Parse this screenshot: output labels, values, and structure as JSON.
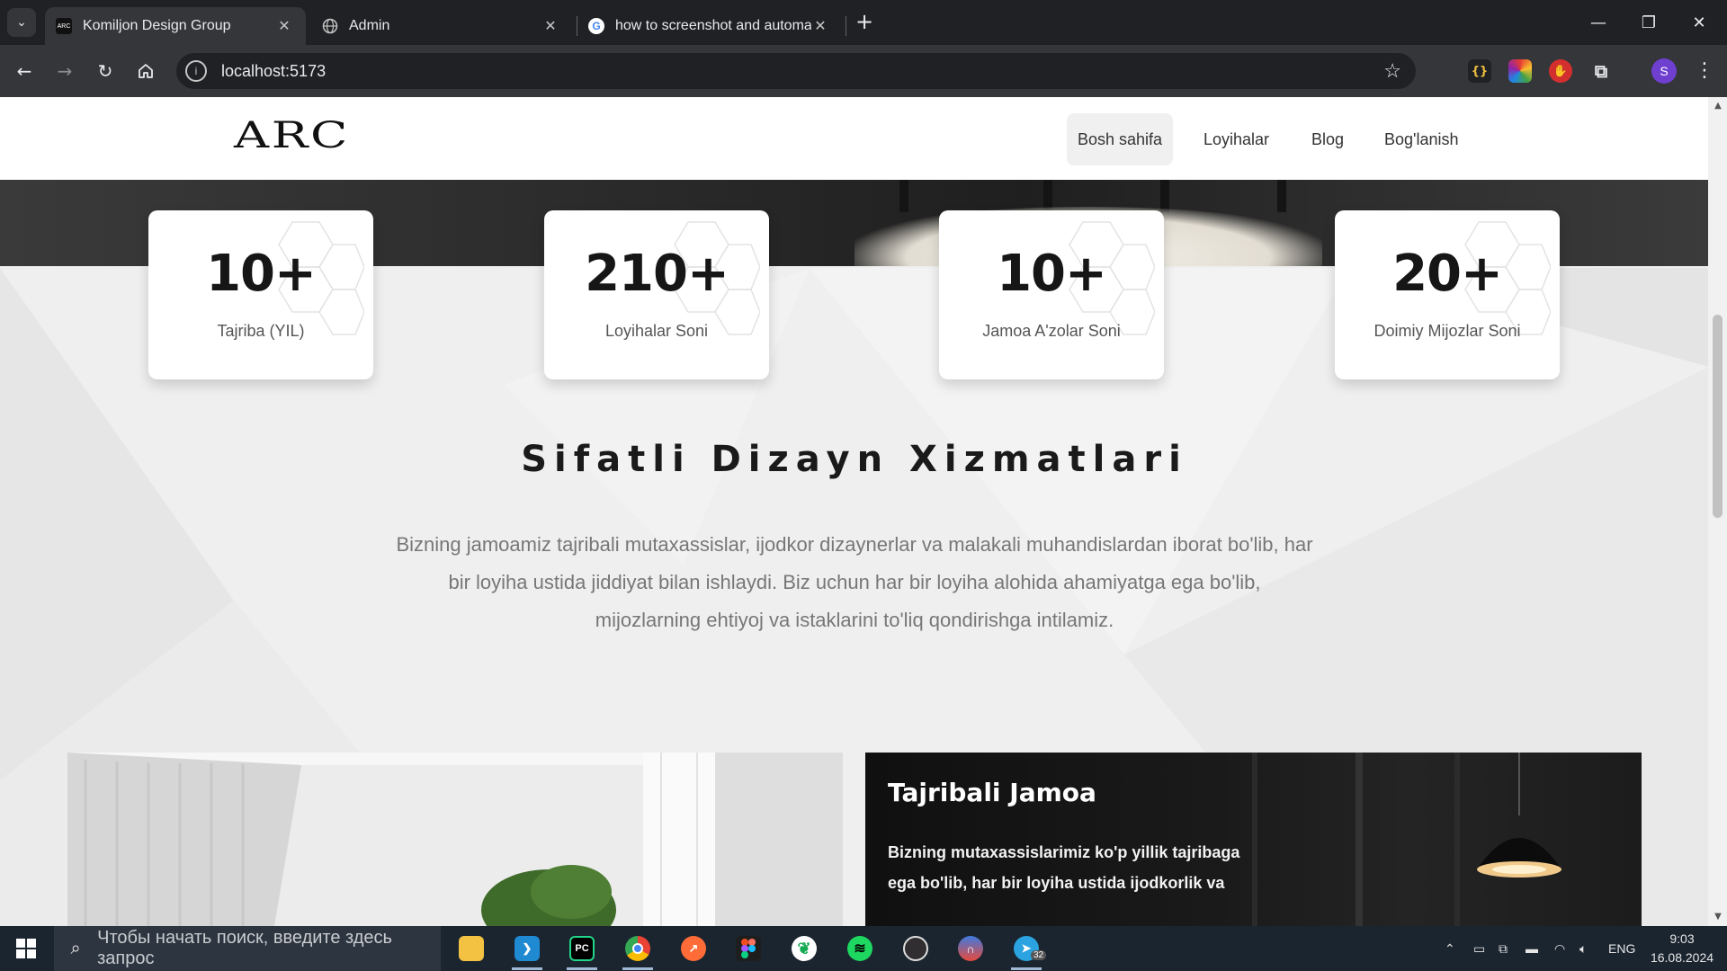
{
  "browser": {
    "tabs": [
      {
        "title": "Komiljon Design Group",
        "favicon": "arc-logo-icon",
        "active": true
      },
      {
        "title": "Admin",
        "favicon": "globe-icon",
        "active": false
      },
      {
        "title": "how to screenshot and automat",
        "favicon": "google-icon",
        "active": false
      }
    ],
    "url": "localhost:5173",
    "profile_initial": "S"
  },
  "site": {
    "logo": "ARC",
    "nav": [
      {
        "label": "Bosh sahifa",
        "active": true
      },
      {
        "label": "Loyihalar",
        "active": false
      },
      {
        "label": "Blog",
        "active": false
      },
      {
        "label": "Bog'lanish",
        "active": false
      }
    ],
    "stats": [
      {
        "number": "10+",
        "label": "Tajriba (YIL)"
      },
      {
        "number": "210+",
        "label": "Loyihalar Soni"
      },
      {
        "number": "10+",
        "label": "Jamoa A'zolar Soni"
      },
      {
        "number": "20+",
        "label": "Doimiy Mijozlar Soni"
      }
    ],
    "section": {
      "title": "Sifatli Dizayn Xizmatlari",
      "description": "Bizning jamoamiz tajribali mutaxassislar, ijodkor dizaynerlar va malakali muhandislardan iborat bo'lib, har bir loyiha ustida jiddiyat bilan ishlaydi. Biz uchun har bir loyiha alohida ahamiyatga ega bo'lib, mijozlarning ehtiyoj va istaklarini to'liq qondirishga intilamiz."
    },
    "feature": {
      "title": "Tajribali Jamoa",
      "text": "Bizning mutaxassislarimiz ko'p yillik tajribaga ega bo'lib, har bir loyiha ustida ijodkorlik va"
    }
  },
  "taskbar": {
    "search_placeholder": "Чтобы начать поиск, введите здесь запрос",
    "apps": [
      "file-explorer-icon",
      "vscode-icon",
      "pycharm-icon",
      "chrome-icon",
      "postman-icon",
      "figma-icon",
      "mongodb-icon",
      "spotify-icon",
      "obs-icon",
      "headphones-app-icon",
      "telegram-icon"
    ],
    "telegram_badge": "32",
    "language": "ENG",
    "time": "9:03",
    "date": "16.08.2024"
  },
  "colors": {
    "chrome_dark": "#202124",
    "chrome_toolbar": "#35363a",
    "page_bg": "#f0f0f0",
    "taskbar": "#1b2530",
    "profile": "#6f3fd0"
  }
}
